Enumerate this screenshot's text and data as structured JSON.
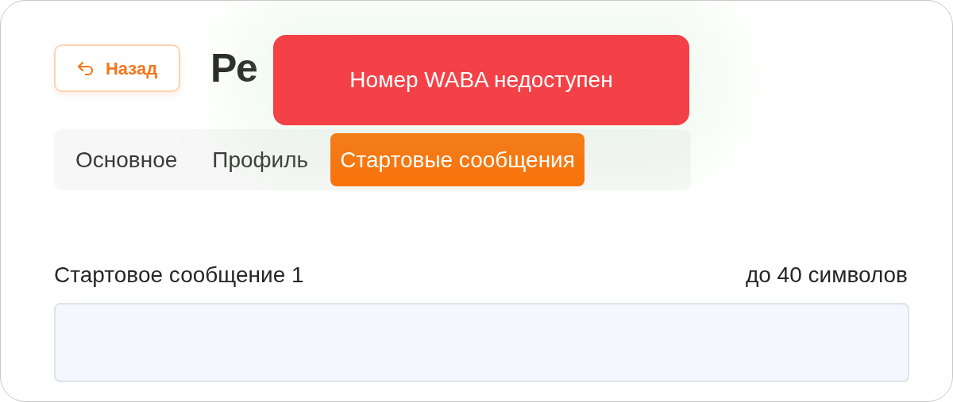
{
  "back_button": {
    "label": "Назад"
  },
  "title": "Ре",
  "toast": {
    "message": "Номер WABA недоступен"
  },
  "tabs": [
    {
      "label": "Основное",
      "selected": false
    },
    {
      "label": "Профиль",
      "selected": false
    },
    {
      "label": "Стартовые сообщения",
      "selected": true
    }
  ],
  "field": {
    "label": "Стартовое сообщение 1",
    "hint": "до 40 символов"
  }
}
